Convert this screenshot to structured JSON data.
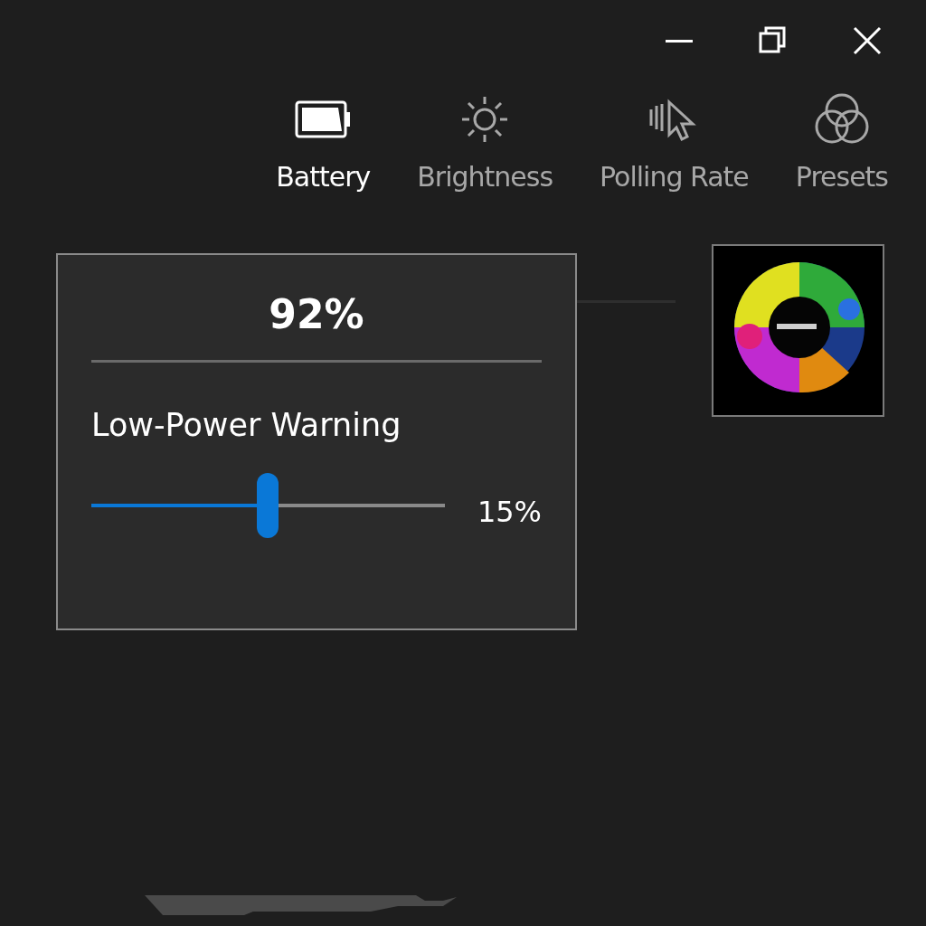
{
  "window_controls": [
    {
      "kind": "minimize"
    },
    {
      "kind": "restore"
    },
    {
      "kind": "close"
    }
  ],
  "tabs": [
    {
      "kind": "battery",
      "label": "Battery",
      "selected": true
    },
    {
      "kind": "brightness",
      "label": "Brightness",
      "selected": false
    },
    {
      "kind": "polling",
      "label": "Polling Rate",
      "selected": false
    },
    {
      "kind": "presets",
      "label": "Presets",
      "selected": false
    }
  ],
  "battery_popup": {
    "charge": "92%",
    "warning_label": "Low-Power Warning",
    "warning_slider": {
      "level": 0.5
    },
    "warning_value": "15%"
  }
}
